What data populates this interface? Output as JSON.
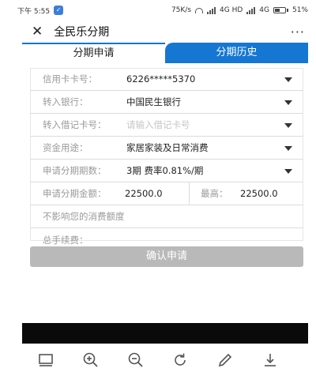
{
  "status_bar": {
    "time": "下午 5:55",
    "speed": "75K/s",
    "network": "4G HD",
    "network2": "4G",
    "battery": "51%",
    "battery_level": 0.51
  },
  "app": {
    "title": "全民乐分期",
    "more": "···"
  },
  "tabs": [
    {
      "label": "分期申请",
      "active": true
    },
    {
      "label": "分期历史",
      "active": false
    }
  ],
  "form": {
    "card": {
      "label": "信用卡卡号：",
      "value": "6226*****5370"
    },
    "bank": {
      "label": "转入银行：",
      "value": "中国民生银行"
    },
    "debit": {
      "label": "转入借记卡号：",
      "placeholder": "请输入借记卡号"
    },
    "purpose": {
      "label": "资金用途：",
      "value": "家居家装及日常消费"
    },
    "periods": {
      "label": "申请分期期数：",
      "value": "3期 费率0.81%/期"
    },
    "amount": {
      "label": "申请分期金额：",
      "value": "22500.0",
      "max_label": "最高：",
      "max_value": "22500.0"
    },
    "note": "不影响您的消费额度",
    "fee": {
      "label": "总手续费："
    }
  },
  "confirm_button": "确认申请",
  "colors": {
    "accent": "#1577d2",
    "button_disabled": "#b9b9b9"
  }
}
